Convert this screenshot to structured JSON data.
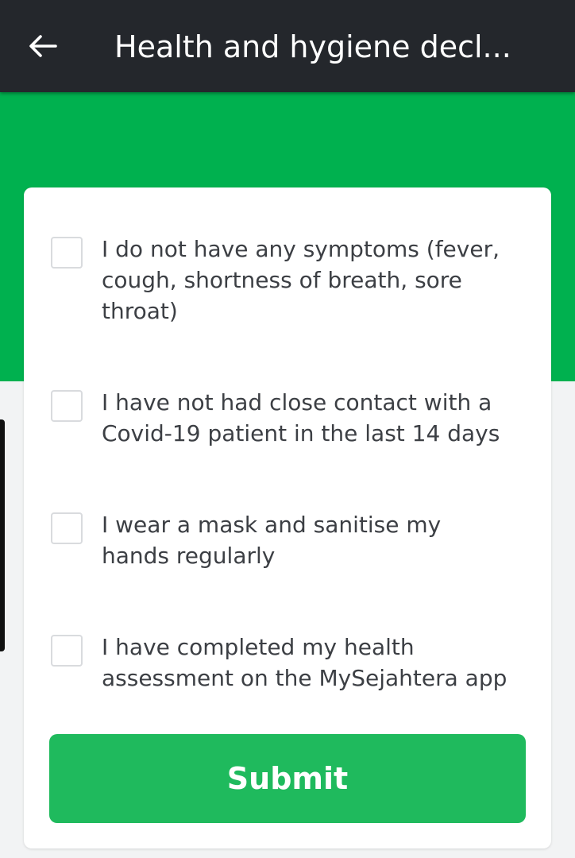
{
  "header": {
    "title": "Health and hygiene decl...",
    "back_icon": "arrow-left-icon"
  },
  "declarations": [
    {
      "label": "I do not have any symptoms (fever, cough, shortness of breath, sore throat)",
      "checked": false
    },
    {
      "label": "I have not had close contact with a Covid-19 patient in the last 14 days",
      "checked": false
    },
    {
      "label": "I wear a mask and sanitise my hands regularly",
      "checked": false
    },
    {
      "label": "I have completed my health assessment on the MySejahtera app",
      "checked": false
    }
  ],
  "submit_label": "Submit",
  "colors": {
    "app_bar": "#24272c",
    "hero_green": "#00b14f",
    "button_green": "#1fba5d",
    "text": "#3c3f44",
    "checkbox_border": "#d9dbde"
  }
}
